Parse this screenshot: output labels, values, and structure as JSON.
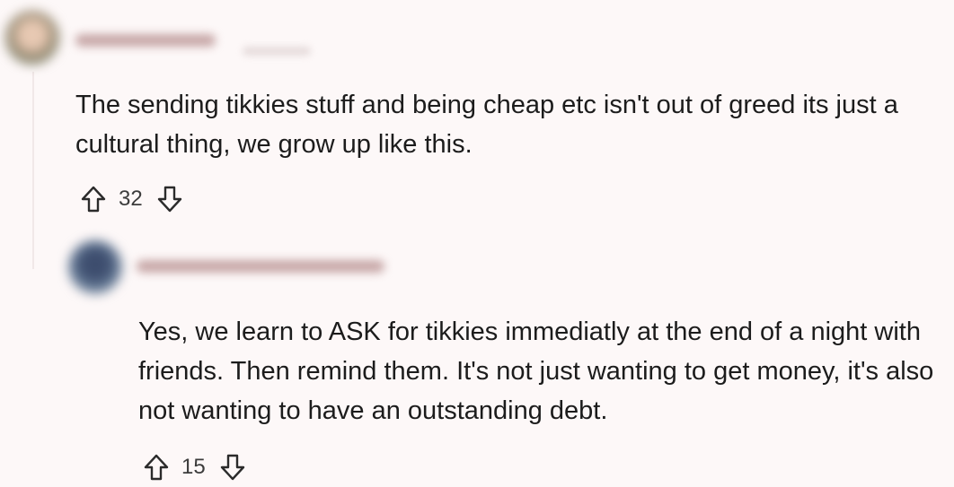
{
  "comments": [
    {
      "body": "The sending tikkies stuff and being cheap etc isn't out of greed its just a cultural thing, we grow up like this.",
      "votes": "32"
    },
    {
      "body": "Yes, we learn to ASK for tikkies immediatly at the end of a night with friends. Then remind them. It's not just wanting to get money, it's also not wanting to have an outstanding debt.",
      "votes": "15"
    }
  ],
  "icons": {
    "upvote": "upvote-arrow-icon",
    "downvote": "downvote-arrow-icon"
  }
}
